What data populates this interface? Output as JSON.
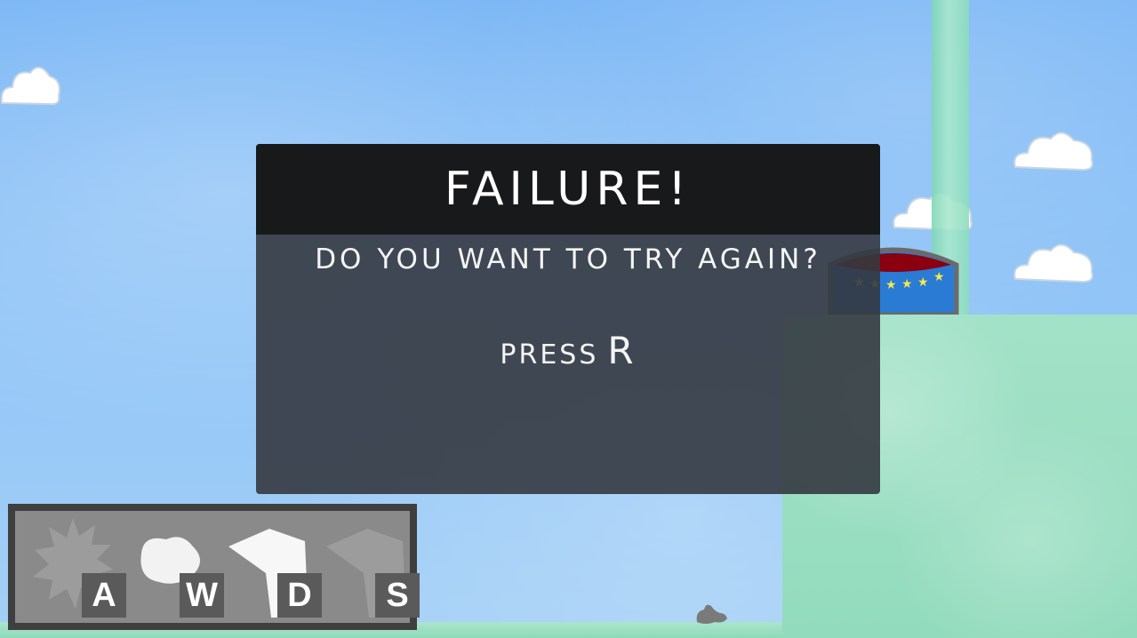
{
  "dialog": {
    "title": "FAILURE!",
    "question": "DO YOU WANT TO TRY AGAIN?",
    "press_word": "PRESS",
    "press_key": "R"
  },
  "controls": {
    "items": [
      {
        "icon": "spiky-burst-icon",
        "key": "A"
      },
      {
        "icon": "blob-icon",
        "key": "W"
      },
      {
        "icon": "white-flag-icon",
        "key": "D"
      },
      {
        "icon": "gray-flag-icon",
        "key": "S"
      }
    ]
  },
  "colors": {
    "sky": "#7ab6f5",
    "dialog_bg": "#343940",
    "dialog_header": "#17191b",
    "ground": "#9ddfc4",
    "controls_bg": "#8a8a8a",
    "key_bg": "#5a5a5a"
  }
}
